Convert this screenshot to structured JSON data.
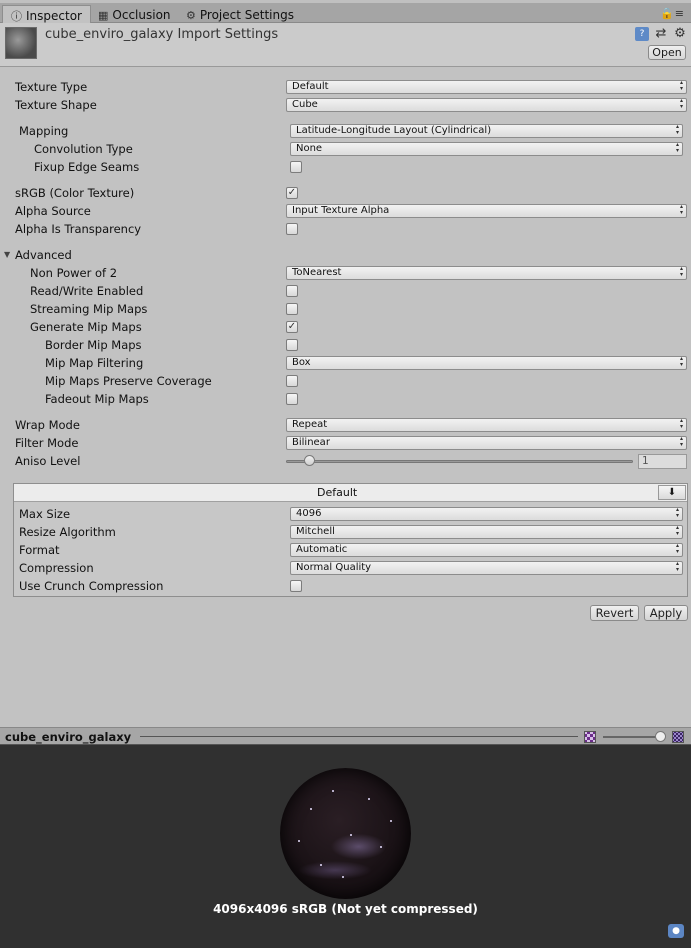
{
  "tabs": [
    {
      "label": "Inspector",
      "icon": "info-icon"
    },
    {
      "label": "Occlusion",
      "icon": "occlusion-icon"
    },
    {
      "label": "Project Settings",
      "icon": "gear-icon"
    }
  ],
  "header": {
    "title": "cube_enviro_galaxy Import Settings",
    "open_label": "Open"
  },
  "settings": {
    "texture_type": {
      "label": "Texture Type",
      "value": "Default"
    },
    "texture_shape": {
      "label": "Texture Shape",
      "value": "Cube"
    },
    "mapping": {
      "label": "Mapping",
      "value": "Latitude-Longitude Layout (Cylindrical)"
    },
    "convolution_type": {
      "label": "Convolution Type",
      "value": "None"
    },
    "fixup_edge_seams": {
      "label": "Fixup Edge Seams",
      "checked": false
    },
    "srgb": {
      "label": "sRGB (Color Texture)",
      "checked": true
    },
    "alpha_source": {
      "label": "Alpha Source",
      "value": "Input Texture Alpha"
    },
    "alpha_is_transparency": {
      "label": "Alpha Is Transparency",
      "checked": false
    },
    "advanced": {
      "label": "Advanced",
      "expanded": true
    },
    "non_power_of_2": {
      "label": "Non Power of 2",
      "value": "ToNearest"
    },
    "read_write": {
      "label": "Read/Write Enabled",
      "checked": false
    },
    "streaming_mips": {
      "label": "Streaming Mip Maps",
      "checked": false
    },
    "generate_mips": {
      "label": "Generate Mip Maps",
      "checked": true
    },
    "border_mips": {
      "label": "Border Mip Maps",
      "checked": false
    },
    "mip_filtering": {
      "label": "Mip Map Filtering",
      "value": "Box"
    },
    "mips_preserve_coverage": {
      "label": "Mip Maps Preserve Coverage",
      "checked": false
    },
    "fadeout_mips": {
      "label": "Fadeout Mip Maps",
      "checked": false
    },
    "wrap_mode": {
      "label": "Wrap Mode",
      "value": "Repeat"
    },
    "filter_mode": {
      "label": "Filter Mode",
      "value": "Bilinear"
    },
    "aniso_level": {
      "label": "Aniso Level",
      "value": "1"
    }
  },
  "platform": {
    "title": "Default",
    "max_size": {
      "label": "Max Size",
      "value": "4096"
    },
    "resize_algorithm": {
      "label": "Resize Algorithm",
      "value": "Mitchell"
    },
    "format": {
      "label": "Format",
      "value": "Automatic"
    },
    "compression": {
      "label": "Compression",
      "value": "Normal Quality"
    },
    "crunch": {
      "label": "Use Crunch Compression",
      "checked": false
    }
  },
  "actions": {
    "revert_label": "Revert",
    "apply_label": "Apply"
  },
  "preview": {
    "title": "cube_enviro_galaxy",
    "info": "4096x4096 sRGB (Not yet compressed)"
  },
  "colors": {
    "panel_bg": "#c2c2c2",
    "preview_bg": "#303030",
    "accent": "#5e8ac7"
  }
}
